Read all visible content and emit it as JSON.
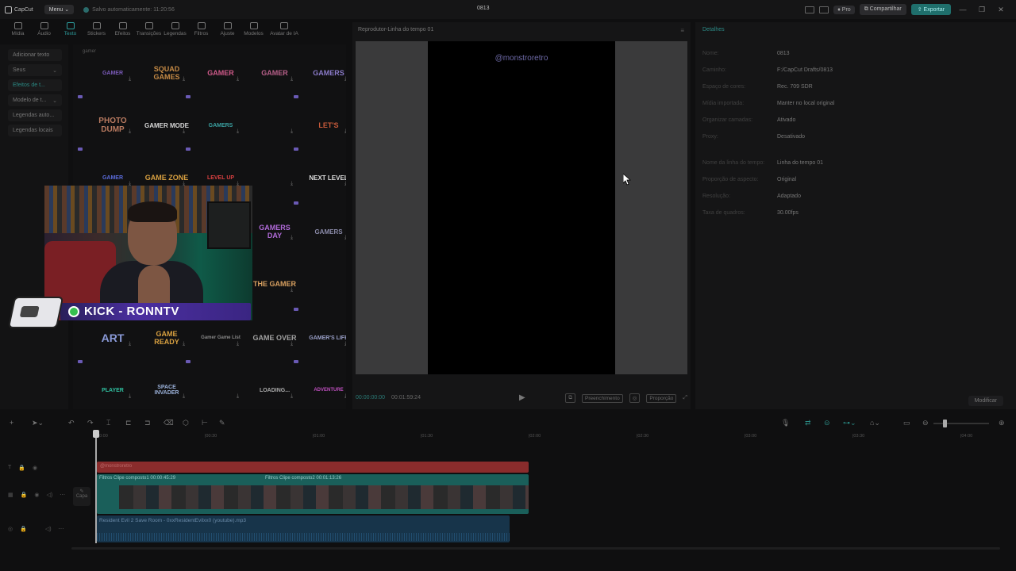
{
  "app": {
    "logo_text": "CapCut",
    "menu": "Menu",
    "saved_status": "Salvo automaticamente: 11:20:56",
    "project_title": "0813",
    "pro": "Pro",
    "share": "Compartilhar",
    "export": "Exportar"
  },
  "tool_tabs": [
    {
      "label": "Mídia",
      "icon": "media-icon"
    },
    {
      "label": "Áudio",
      "icon": "audio-icon"
    },
    {
      "label": "Texto",
      "icon": "text-icon",
      "active": true
    },
    {
      "label": "Stickers",
      "icon": "sticker-icon"
    },
    {
      "label": "Efeitos",
      "icon": "effects-icon"
    },
    {
      "label": "Transições",
      "icon": "transitions-icon"
    },
    {
      "label": "Legendas",
      "icon": "captions-icon"
    },
    {
      "label": "Filtros",
      "icon": "filters-icon"
    },
    {
      "label": "Ajuste",
      "icon": "adjust-icon"
    },
    {
      "label": "Modelos",
      "icon": "templates-icon"
    },
    {
      "label": "Avatar de IA",
      "icon": "ai-avatar-icon"
    }
  ],
  "side_menu": [
    "Adicionar texto",
    "Seus",
    "Efeitos de t...",
    "Modelo de t...",
    "Legendas auto...",
    "Legendas locais"
  ],
  "grid": {
    "search": "gamer",
    "items": [
      "GAMER",
      "SQUAD GAMES",
      "GAMER",
      "GAMER",
      "GAMERS",
      "PHOTO DUMP",
      "GAMER MODE",
      "GAMERS",
      "",
      "LET'S",
      "GAMER",
      "GAME ZONE",
      "LEVEL UP",
      "",
      "NEXT LEVEL",
      "GAMERS DAY",
      "GAMERS",
      "THE GAMER",
      "ART",
      "GAME READY",
      "Gamer Game List",
      "GAME OVER",
      "GAMER'S LIFE",
      "PLAYER",
      "SPACE INVADER",
      "",
      "LOADING...",
      "ADVENTURE"
    ]
  },
  "overlay": {
    "banner_text": "KICK - RONNTV"
  },
  "player": {
    "title": "Reprodutor-Linha do tempo 01",
    "watermark": "@monstroretro",
    "current_time": "00:00:00:00",
    "total_time": "00:01:59:24",
    "fill": "Preenchimento",
    "ratio": "Proporção"
  },
  "details": {
    "title": "Detalhes",
    "rows": [
      {
        "k": "Nome:",
        "v": "0813"
      },
      {
        "k": "Caminho:",
        "v": "F:/CapCut Drafts/0813"
      },
      {
        "k": "Espaço de cores:",
        "v": "Rec. 709 SDR"
      },
      {
        "k": "Mídia importada:",
        "v": "Manter no local original"
      },
      {
        "k": "Organizar camadas:",
        "v": "Ativado"
      },
      {
        "k": "Proxy:",
        "v": "Desativado"
      },
      {
        "k": "Nome da linha do tempo:",
        "v": "Linha do tempo 01"
      },
      {
        "k": "Proporção de aspecto:",
        "v": "Original"
      },
      {
        "k": "Resolução:",
        "v": "Adaptado"
      },
      {
        "k": "Taxa de quadros:",
        "v": "30.00fps"
      }
    ],
    "modify": "Modificar"
  },
  "timeline": {
    "ruler": [
      "00:00",
      "|00:30",
      "|01:00",
      "|01:30",
      "|02:00",
      "|02:30",
      "|03:00",
      "|03:30",
      "|04:00"
    ],
    "text_clip": "@monstroretro",
    "clip1": "Filtros  Clipe composto1  00:00:45:29",
    "clip2": "Filtros  Clipe composto2  00:01:13:26",
    "covers": "Capa",
    "audio": "Resident Evil 2 Save Room - 0xxResidentEvilxx0 (youtube).mp3"
  }
}
